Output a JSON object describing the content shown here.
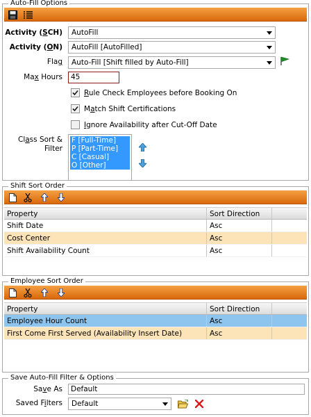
{
  "autofill": {
    "legend": "Auto-Fill Options",
    "activity_sch": {
      "label_pre": "Activity (",
      "label_u": "S",
      "label_post": "CH)",
      "value": "AutoFill"
    },
    "activity_on": {
      "label_pre": "Activity (",
      "label_u": "O",
      "label_post": "N)",
      "value": "AutoFill [AutoFilled]"
    },
    "flag": {
      "label_pre": "Fla",
      "label_u": "g",
      "label_post": "",
      "value": "Auto-Fill [Shift filled by Auto-Fill]"
    },
    "max_hours": {
      "label_pre": "Ma",
      "label_u": "x",
      "label_post": " Hours",
      "value": "45"
    },
    "rule_check": {
      "label_pre": "",
      "label_u": "R",
      "label_post": "ule Check Employees before Booking On",
      "checked": true
    },
    "match_cert": {
      "label_pre": "M",
      "label_u": "a",
      "label_post": "tch Shift Certifications",
      "checked": true
    },
    "ignore_avail": {
      "label_pre": "",
      "label_u": "I",
      "label_post": "gnore Availability after Cut-Off Date",
      "checked": false
    },
    "class_sort": {
      "label_line1_pre": "Cl",
      "label_line1_u": "a",
      "label_line1_post": "ss Sort &",
      "label_line2": "Filter",
      "options": [
        "F [Full-Time]",
        "P [Part-Time]",
        "C [Casual]",
        "O [Other]"
      ]
    }
  },
  "shift_sort": {
    "legend": "Shift Sort Order",
    "columns": [
      "Property",
      "Sort Direction"
    ],
    "rows": [
      {
        "property": "Shift Date",
        "direction": "Asc"
      },
      {
        "property": "Cost Center",
        "direction": "Asc"
      },
      {
        "property": "Shift Availability Count",
        "direction": "Asc"
      }
    ]
  },
  "employee_sort": {
    "legend": "Employee Sort Order",
    "columns": [
      "Property",
      "Sort Direction"
    ],
    "rows": [
      {
        "property": "Employee Hour Count",
        "direction": "Asc"
      },
      {
        "property": "First Come First Served (Availability Insert Date)",
        "direction": "Asc"
      }
    ]
  },
  "save": {
    "legend": "Save Auto-Fill Filter & Options",
    "save_as": {
      "label_pre": "Sa",
      "label_u": "v",
      "label_post": "e As",
      "value": "Default"
    },
    "saved_filters": {
      "label_pre": "Saved F",
      "label_u": "i",
      "label_post": "lters",
      "value": "Default"
    }
  },
  "colors": {
    "toolbar": "#e07b1b",
    "row_alt": "#fde3b8",
    "row_selected": "#8ec5ee",
    "list_selected": "#3399ff"
  }
}
